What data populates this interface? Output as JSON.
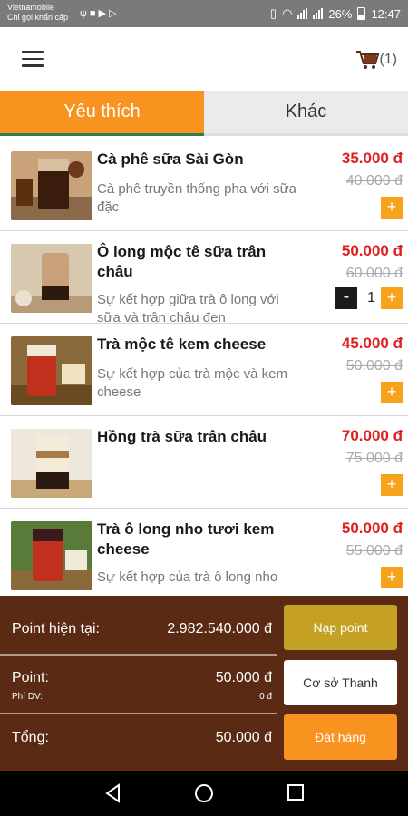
{
  "status_bar": {
    "carrier_line1": "Vietnamobile",
    "carrier_line2": "Chỉ gọi khẩn cấp",
    "battery": "26%",
    "time": "12:47"
  },
  "header": {
    "cart_count": "(1)"
  },
  "tabs": [
    {
      "label": "Yêu thích",
      "active": true
    },
    {
      "label": "Khác",
      "active": false
    }
  ],
  "products": [
    {
      "name": "Cà phê sữa Sài Gòn",
      "description": "Cà phê truyền thống pha với sữa đặc",
      "price": "35.000 đ",
      "old_price": "40.000 đ",
      "plus_label": "+"
    },
    {
      "name": "Ô long mộc tê sữa trân châu",
      "description": "Sự kết hợp giữa trà ô long với sữa và trân châu đen",
      "price": "50.000 đ",
      "old_price": "60.000 đ",
      "plus_label": "+",
      "minus_label": "-",
      "quantity": "1"
    },
    {
      "name": "Trà mộc tê kem cheese",
      "description": "Sự kết hợp của trà mộc và kem cheese",
      "price": "45.000 đ",
      "old_price": "50.000 đ",
      "plus_label": "+"
    },
    {
      "name": "Hồng trà sữa trân châu",
      "description": "",
      "price": "70.000 đ",
      "old_price": "75.000 đ",
      "plus_label": "+"
    },
    {
      "name": "Trà ô long nho tươi kem cheese",
      "description": "Sự kết hợp của trà ô long nho",
      "price": "50.000 đ",
      "old_price": "55.000 đ",
      "plus_label": "+"
    }
  ],
  "summary": {
    "point_current_label": "Point hiện tại:",
    "point_current_value": "2.982.540.000 đ",
    "point_label": "Point:",
    "point_value": "50.000 đ",
    "service_fee_label": "Phí DV:",
    "service_fee_value": "0 đ",
    "total_label": "Tổng:",
    "total_value": "50.000 đ"
  },
  "buttons": {
    "topup": "Nạp point",
    "branch": "Cơ sở Thanh",
    "order": "Đặt hàng"
  },
  "colors": {
    "accent": "#f7931e",
    "price": "#e02020",
    "panel": "#5b2a14",
    "topup": "#c4a024"
  },
  "icons": [
    "menu-icon",
    "cart-icon",
    "back-icon",
    "home-icon",
    "recents-icon"
  ]
}
